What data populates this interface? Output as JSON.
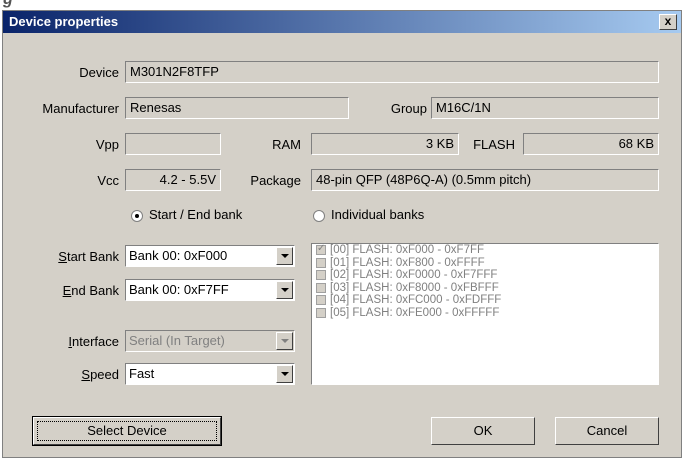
{
  "window": {
    "title": "Device properties",
    "close_label": "x"
  },
  "labels": {
    "device": "Device",
    "manufacturer": "Manufacturer",
    "group": "Group",
    "vpp": "Vpp",
    "ram": "RAM",
    "flash": "FLASH",
    "vcc": "Vcc",
    "package": "Package",
    "start_bank_rest": "tart Bank",
    "start_bank_key": "S",
    "end_bank_key": "E",
    "end_bank_rest": "nd Bank",
    "interface_key": "I",
    "interface_rest": "nterface",
    "speed_key": "S",
    "speed_rest": "peed"
  },
  "fields": {
    "device": "M301N2F8TFP",
    "manufacturer": "Renesas",
    "group": "M16C/1N",
    "vpp": "",
    "ram": "3 KB",
    "flash": "68 KB",
    "vcc": "4.2 - 5.5V",
    "package": "48-pin QFP (48P6Q-A) (0.5mm pitch)"
  },
  "radios": {
    "start_end": {
      "label": "Start / End bank",
      "selected": true
    },
    "individual": {
      "label": "Individual banks",
      "selected": false
    }
  },
  "selects": {
    "start_bank": "Bank 00: 0xF000",
    "end_bank": "Bank 00: 0xF7FF",
    "interface": "Serial (In Target)",
    "speed": "Fast"
  },
  "banks": [
    {
      "label": "[00] FLASH: 0xF000 - 0xF7FF",
      "checked": true
    },
    {
      "label": "[01] FLASH: 0xF800 - 0xFFFF",
      "checked": false
    },
    {
      "label": "[02] FLASH: 0xF0000 - 0xF7FFF",
      "checked": false
    },
    {
      "label": "[03] FLASH: 0xF8000 - 0xFBFFF",
      "checked": false
    },
    {
      "label": "[04] FLASH: 0xFC000 - 0xFDFFF",
      "checked": false
    },
    {
      "label": "[05] FLASH: 0xFE000 - 0xFFFFF",
      "checked": false
    }
  ],
  "buttons": {
    "select_device": "Select Device",
    "ok": "OK",
    "cancel": "Cancel"
  },
  "page_caption_fragment": "g"
}
